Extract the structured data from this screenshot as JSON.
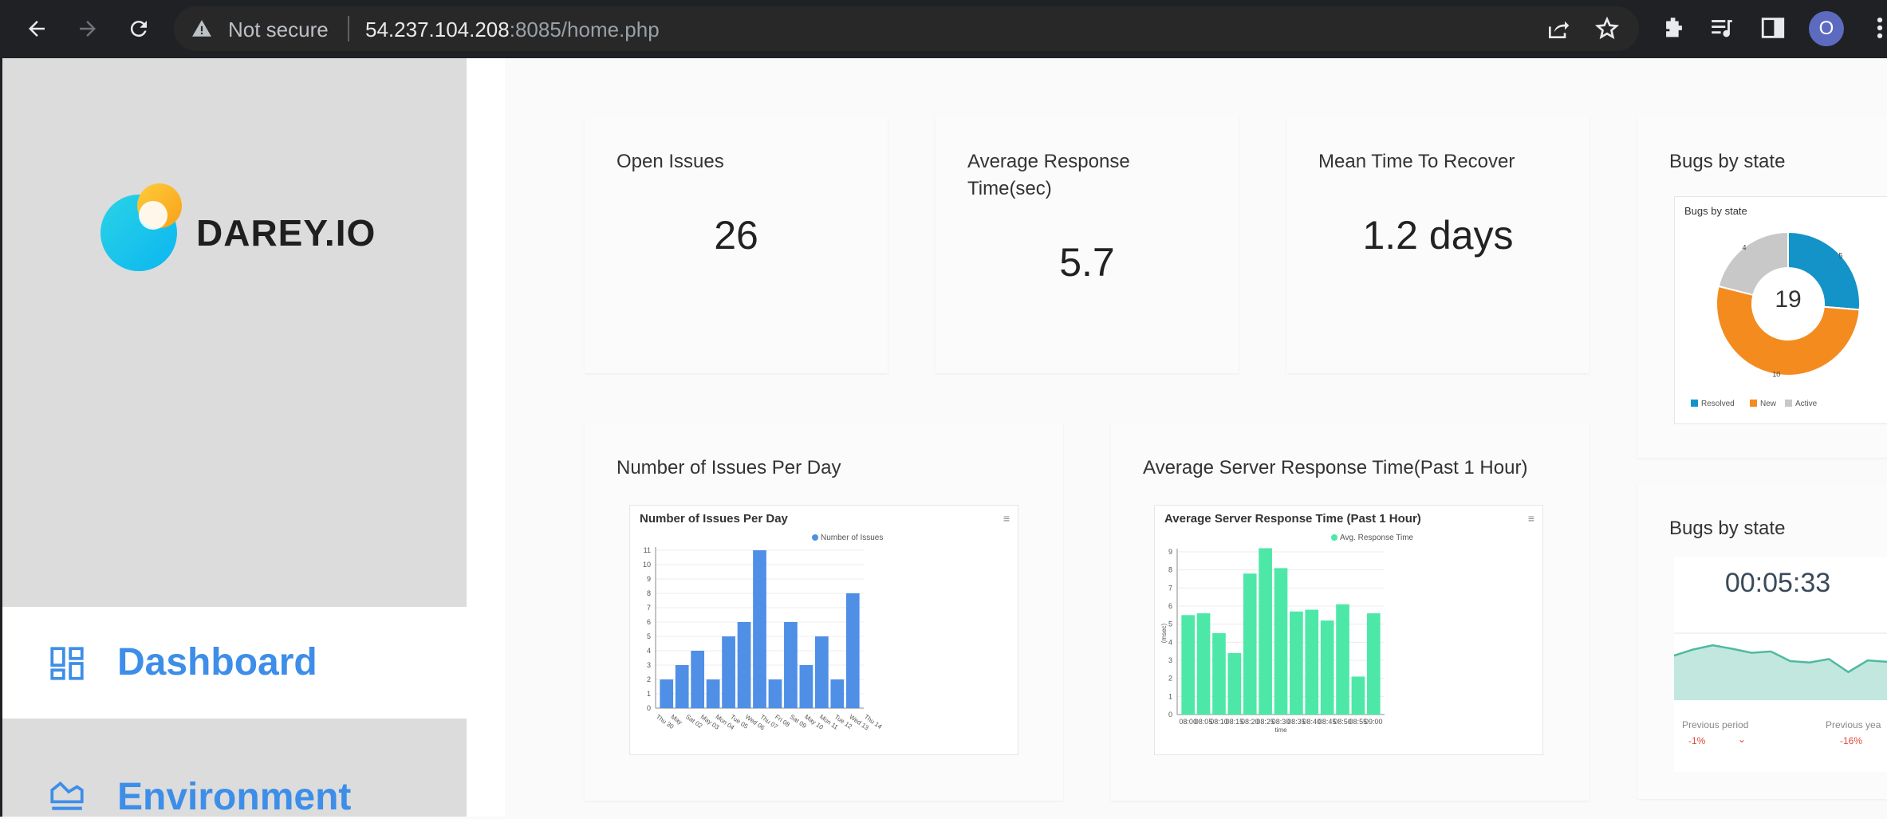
{
  "browser": {
    "security_text": "Not secure",
    "url_host": "54.237.104.208",
    "url_rest": ":8085/home.php",
    "profile_initial": "O"
  },
  "sidebar": {
    "brand": "DAREY.IO",
    "items": [
      {
        "label": "Dashboard",
        "icon": "dashboard-icon",
        "active": true
      },
      {
        "label": "Environment",
        "icon": "area-chart-icon",
        "active": false
      }
    ]
  },
  "cards": {
    "open_issues": {
      "title": "Open Issues",
      "value": "26"
    },
    "avg_response": {
      "title_line1": "Average Response",
      "title_line2": "Time(sec)",
      "value": "5.7"
    },
    "mttr": {
      "title": "Mean Time To Recover",
      "value": "1.2 days"
    },
    "bugs_state_1": {
      "title": "Bugs by state"
    },
    "issues_per_day": {
      "title": "Number of Issues Per Day"
    },
    "server_response": {
      "title": "Average Server Response Time(Past 1 Hour)"
    },
    "bugs_state_2": {
      "title": "Bugs by state"
    }
  },
  "chart_data": [
    {
      "type": "pie",
      "title": "Bugs by state",
      "center_label": "19",
      "slices": [
        {
          "name": "Resolved",
          "value": 5,
          "color": "#1393c7"
        },
        {
          "name": "New",
          "value": 10,
          "color": "#f48b1f"
        },
        {
          "name": "Active",
          "value": 4,
          "color": "#c8c8c8"
        }
      ]
    },
    {
      "type": "bar",
      "title": "Number of Issues Per Day",
      "series": [
        {
          "name": "Number of Issues",
          "color": "#4f8fe6",
          "values": [
            2,
            3,
            4,
            2,
            5,
            6,
            11,
            2,
            6,
            3,
            5,
            2,
            8
          ]
        }
      ],
      "categories": [
        "Thu 30",
        "May",
        "Sat 02",
        "May 03",
        "Mon 04",
        "Tue 05",
        "Wed 06",
        "Thu 07",
        "Fri 08",
        "Sat 09",
        "May 10",
        "Mon 11",
        "Tue 12",
        "Wed 13",
        "Thu 14"
      ],
      "yticks": [
        "0",
        "1",
        "2",
        "3",
        "4",
        "5",
        "6",
        "7",
        "8",
        "9",
        "10",
        "11"
      ],
      "ylim": [
        0,
        11
      ]
    },
    {
      "type": "bar",
      "title": "Average Server Response Time (Past 1 Hour)",
      "ylabel": "(msec)",
      "xlabel": "time",
      "series": [
        {
          "name": "Avg. Response Time",
          "color": "#4de8a8",
          "values": [
            5.5,
            5.6,
            4.5,
            3.4,
            7.8,
            9.2,
            8.1,
            5.7,
            5.8,
            5.2,
            6.1,
            2.1,
            5.6
          ]
        }
      ],
      "categories": [
        "08:00",
        "08:05",
        "08:10",
        "08:15",
        "08:20",
        "08:25",
        "08:30",
        "08:35",
        "08:40",
        "08:45",
        "08:50",
        "08:55",
        "09:00"
      ],
      "yticks": [
        "0",
        "1",
        "2",
        "3",
        "4",
        "5",
        "6",
        "7",
        "8",
        "9"
      ],
      "ylim": [
        0,
        9
      ]
    },
    {
      "type": "area",
      "title": "",
      "header_value": "00:05:33",
      "values": [
        6.5,
        7.4,
        8.0,
        7.5,
        6.9,
        7.1,
        5.7,
        5.5,
        6.0,
        4.1,
        5.8,
        5.6
      ],
      "color": "#4fb9a0",
      "footer": [
        {
          "label": "Previous period",
          "delta": "-1%"
        },
        {
          "label": "Previous yea",
          "delta": "-16%"
        }
      ]
    }
  ]
}
